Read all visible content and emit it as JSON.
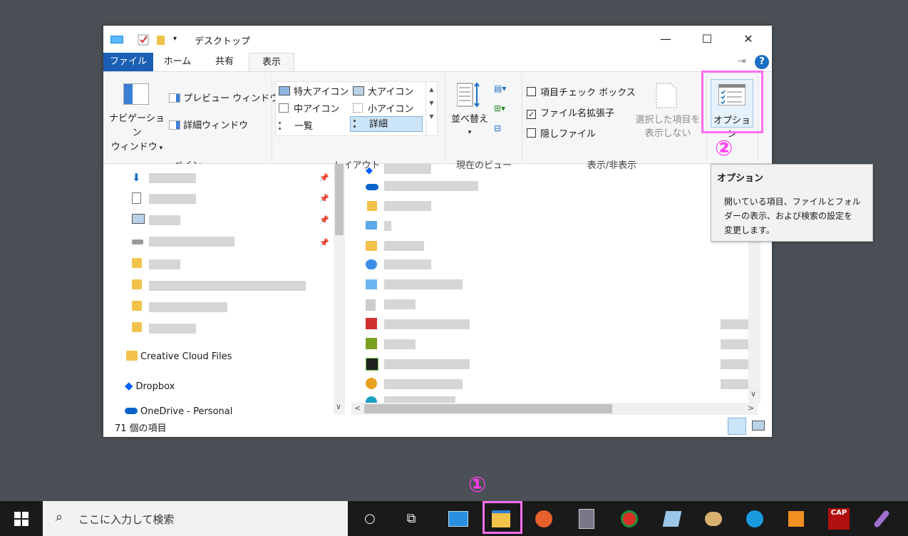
{
  "window": {
    "title": "デスクトップ",
    "controls": {
      "minimize": "—",
      "maximize": "☐",
      "close": "✕"
    }
  },
  "ribbon_tabs": [
    {
      "label": "ファイル"
    },
    {
      "label": "ホーム"
    },
    {
      "label": "共有"
    },
    {
      "label": "表示"
    }
  ],
  "ribbon": {
    "pane_group": {
      "nav_pane_line1": "ナビゲーション",
      "nav_pane_line2": "ウィンドウ",
      "preview_pane": "プレビュー ウィンドウ",
      "details_pane": "詳細ウィンドウ",
      "group_label": "ペイン"
    },
    "layout_group": {
      "items": [
        "特大アイコン",
        "大アイコン",
        "中アイコン",
        "小アイコン",
        "一覧",
        "詳細"
      ],
      "selected": "詳細",
      "group_label": "レイアウト"
    },
    "view_group": {
      "sort_label": "並べ替え",
      "group_label": "現在のビュー"
    },
    "showhide_group": {
      "item_checkbox": "項目チェック ボックス",
      "extensions": "ファイル名拡張子",
      "hidden": "隠しファイル",
      "hide_selected_line1": "選択した項目を",
      "hide_selected_line2": "表示しない",
      "group_label": "表示/非表示"
    },
    "options_label": "オプション"
  },
  "nav_pane": {
    "named_items": [
      "Creative Cloud Files",
      "Dropbox",
      "OneDrive - Personal"
    ]
  },
  "status_bar": {
    "item_count": "71 個の項目"
  },
  "tooltip": {
    "title": "オプション",
    "body_line1": "開いている項目、ファイルとフォル",
    "body_line2": "ダーの表示、および検索の設定を",
    "body_line3": "変更します。"
  },
  "taskbar": {
    "search_placeholder": "ここに入力して検索",
    "cap_label": "CAP"
  },
  "annotations": {
    "marker1": "①",
    "marker2": "②"
  },
  "colors": {
    "file_tab": "#1a5fb4",
    "highlight": "#ff6ef0",
    "taskbar": "#1a1a1a"
  }
}
